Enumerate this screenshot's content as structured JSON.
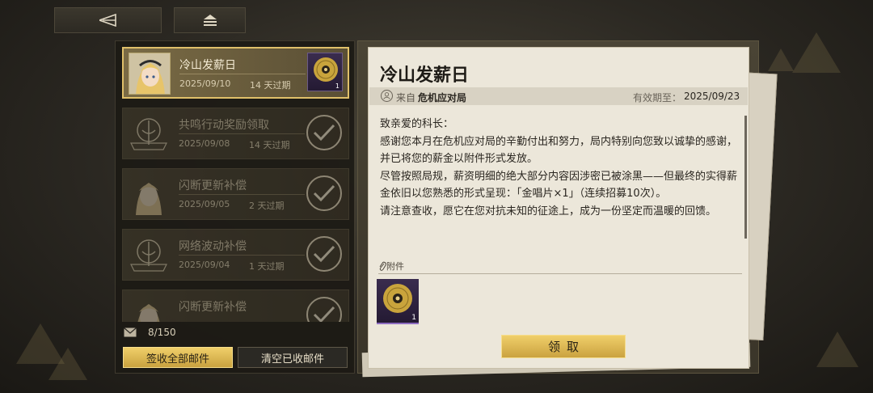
{
  "nav": {
    "back_icon": "back-arrow-icon",
    "home_icon": "home-menu-icon"
  },
  "mail_list": {
    "items": [
      {
        "title": "冷山发薪日",
        "date": "2025/09/10",
        "expiry": "14 天过期",
        "state": "selected",
        "thumb": "portrait-blonde-girl",
        "reward_count": "1"
      },
      {
        "title": "共鸣行动奖励领取",
        "date": "2025/09/08",
        "expiry": "14 天过期",
        "state": "claimed",
        "thumb": "organization-emblem"
      },
      {
        "title": "闪断更新补偿",
        "date": "2025/09/05",
        "expiry": "2 天过期",
        "state": "claimed",
        "thumb": "portrait-blonde-girl"
      },
      {
        "title": "网络波动补偿",
        "date": "2025/09/04",
        "expiry": "1 天过期",
        "state": "claimed",
        "thumb": "organization-emblem"
      },
      {
        "title": "闪断更新补偿",
        "date": "",
        "expiry": "",
        "state": "claimed",
        "thumb": "portrait-blonde-girl"
      }
    ],
    "count": "8/150",
    "claim_all_label": "签收全部邮件",
    "clear_label": "清空已收邮件"
  },
  "letter": {
    "title": "冷山发薪日",
    "from_label": "来自",
    "from_value": "危机应对局",
    "expiry_label": "有效期至：",
    "expiry_value": "2025/09/23",
    "body": [
      "致亲爱的科长：",
      "感谢您本月在危机应对局的辛勤付出和努力，局内特别向您致以诚挚的感谢，并已将您的薪金以附件形式发放。",
      "尽管按照局规，薪资明细的绝大部分内容因涉密已被涂黑——但最终的实得薪金依旧以您熟悉的形式呈现：「金唱片×1」（连续招募10次）。",
      "请注意查收，愿它在您对抗未知的征途上，成为一份坚定而温暖的回馈。"
    ],
    "attachment_label": "附件",
    "attachment_count": "1",
    "attachment_icon": "gold-record-icon",
    "receive_label": "领取"
  },
  "colors": {
    "accent_gold": "#e0c06a",
    "paper": "#ece7da",
    "panel_dark": "#1c1a15"
  }
}
